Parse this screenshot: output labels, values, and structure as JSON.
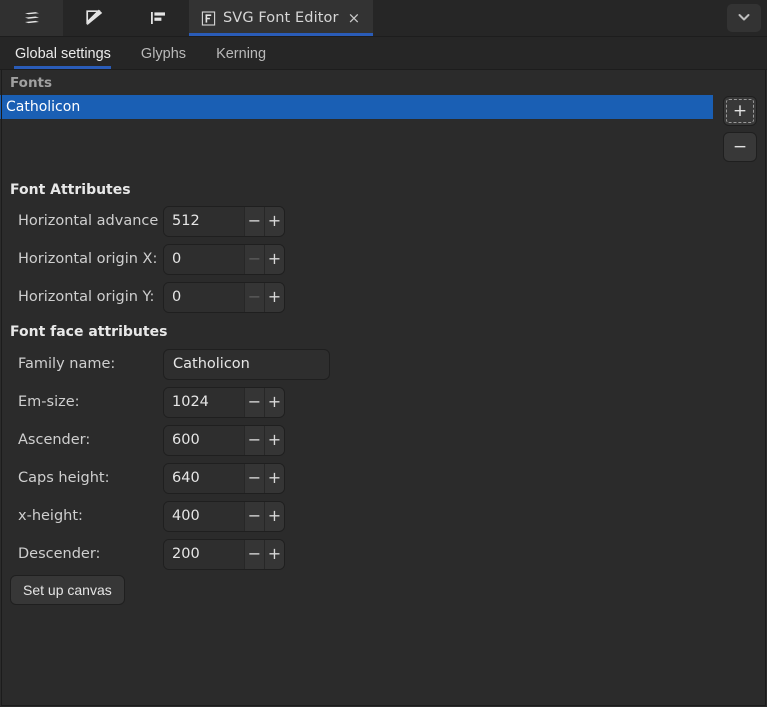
{
  "window": {
    "dock_icons": [
      {
        "name": "layers-icon",
        "title": "Layers"
      },
      {
        "name": "pencil-edit-icon",
        "title": "Edit"
      },
      {
        "name": "align-left-icon",
        "title": "Align"
      }
    ],
    "active_tab": {
      "icon": "font-f-icon",
      "label": "SVG Font Editor",
      "close": "×"
    },
    "chevron": "chevron-down-icon"
  },
  "inner_tabs": [
    {
      "label": "Global settings",
      "active": true
    },
    {
      "label": "Glyphs",
      "active": false
    },
    {
      "label": "Kerning",
      "active": false
    }
  ],
  "fonts_section": {
    "label": "Fonts",
    "items": [
      {
        "name": "Catholicon",
        "selected": true
      }
    ],
    "add_button": "+",
    "remove_button": "−"
  },
  "font_attributes": {
    "title": "Font Attributes",
    "fields": [
      {
        "label": "Horizontal advance X:",
        "value": "512",
        "minus_disabled": false
      },
      {
        "label": "Horizontal origin X:",
        "value": "0",
        "minus_disabled": true
      },
      {
        "label": "Horizontal origin Y:",
        "value": "0",
        "minus_disabled": true
      }
    ]
  },
  "font_face_attributes": {
    "title": "Font face attributes",
    "family_name": {
      "label": "Family name:",
      "value": "Catholicon"
    },
    "fields": [
      {
        "label": "Em-size:",
        "value": "1024",
        "minus_disabled": false
      },
      {
        "label": "Ascender:",
        "value": "600",
        "minus_disabled": false
      },
      {
        "label": "Caps height:",
        "value": "640",
        "minus_disabled": false
      },
      {
        "label": "x-height:",
        "value": "400",
        "minus_disabled": false
      },
      {
        "label": "Descender:",
        "value": "200",
        "minus_disabled": false
      }
    ],
    "setup_canvas_button": "Set up canvas"
  },
  "spin_controls": {
    "minus": "−",
    "plus": "+"
  },
  "colors": {
    "background": "#2b2b2b",
    "header": "#262626",
    "accent_blue": "#2a5cb8",
    "selection_blue": "#1a5fb4",
    "text": "#e0e0e0"
  }
}
